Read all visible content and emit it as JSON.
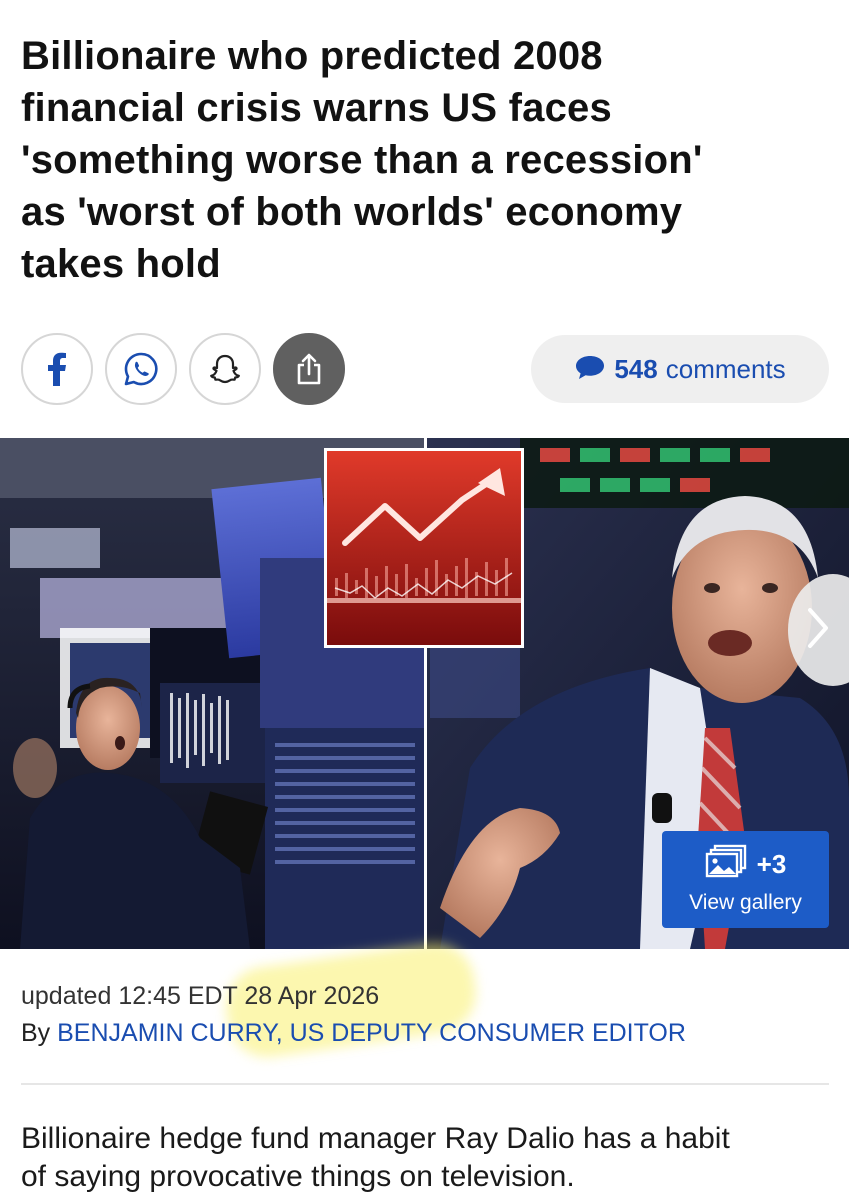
{
  "article": {
    "headline_lines": [
      "Billionaire who predicted 2008",
      "financial crisis warns US faces",
      "'something worse than a recession'",
      "as 'worst of both worlds' economy",
      "takes hold"
    ],
    "updated": "updated 12:45 EDT 28 Apr 2026",
    "byline_prefix": "By ",
    "author": "BENJAMIN CURRY, US DEPUTY CONSUMER EDITOR",
    "lead_lines": [
      "Billionaire hedge fund manager Ray Dalio has a habit",
      "of saying provocative things on television."
    ]
  },
  "share": {
    "icons": [
      "facebook-icon",
      "whatsapp-icon",
      "snapchat-icon",
      "share-icon"
    ],
    "comment_count": "548",
    "comment_word": "comments"
  },
  "gallery": {
    "plus": "+3",
    "label": "View gallery",
    "icon": "gallery-icon"
  },
  "colors": {
    "accent_blue": "#1a4db0",
    "gallery_blue": "#1d5cc7",
    "highlight_yellow": "#faf06e"
  }
}
